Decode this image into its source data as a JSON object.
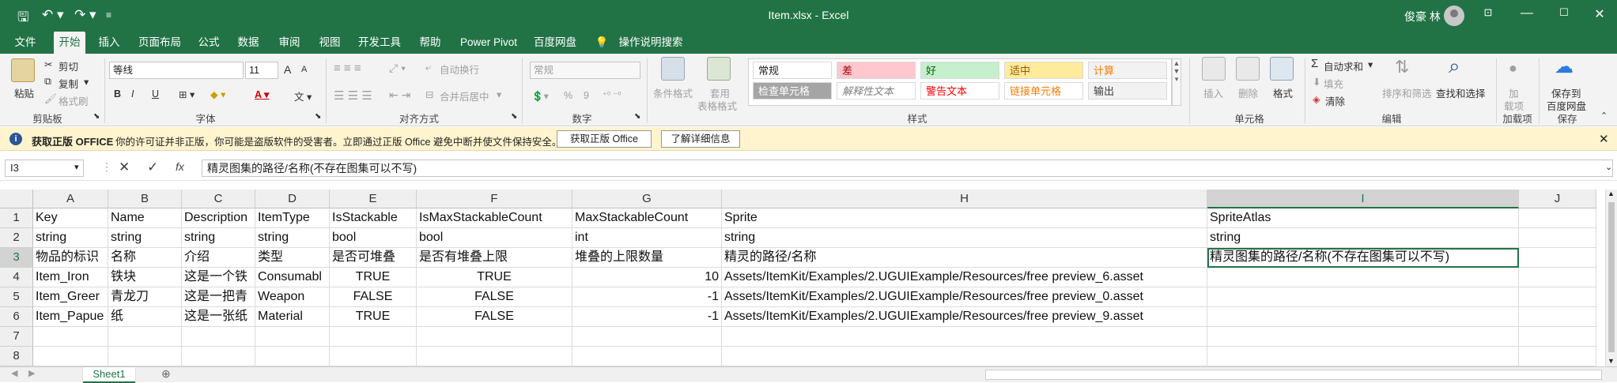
{
  "window": {
    "title": "Item.xlsx  -  Excel",
    "user": "俊豪 林",
    "accent": "#217346",
    "icons": {
      "save": "save-icon",
      "undo": "undo-icon",
      "redo": "redo-icon",
      "customize": "customize-quick-access-icon",
      "ribbon_display": "ribbon-display-options-icon",
      "minimize": "minimize-icon",
      "maximize": "maximize-icon",
      "close": "close-icon"
    }
  },
  "menu": {
    "tabs": [
      "文件",
      "开始",
      "插入",
      "页面布局",
      "公式",
      "数据",
      "审阅",
      "视图",
      "开发工具",
      "帮助",
      "Power Pivot",
      "百度网盘"
    ],
    "active": "开始",
    "search": "操作说明搜索"
  },
  "ribbon": {
    "clipboard": {
      "paste": "粘贴",
      "cut": "剪切",
      "copy": "复制",
      "format_painter": "格式刷",
      "label": "剪贴板"
    },
    "font": {
      "name": "等线",
      "size": "11",
      "grow": "A",
      "shrink": "A",
      "bold": "B",
      "italic": "I",
      "underline": "U",
      "label": "字体"
    },
    "alignment": {
      "wrap": "自动换行",
      "merge": "合并后居中",
      "label": "对齐方式"
    },
    "number": {
      "format": "常规",
      "percent": "%",
      "comma": "9",
      "label": "数字"
    },
    "styles": {
      "conditional": "条件格式",
      "table": "套用",
      "table2": "表格格式",
      "cells": [
        {
          "text": "常规",
          "bg": "#ffffff",
          "fg": "#222222"
        },
        {
          "text": "差",
          "bg": "#ffc7ce",
          "fg": "#9c0006"
        },
        {
          "text": "好",
          "bg": "#c6efce",
          "fg": "#006100"
        },
        {
          "text": "适中",
          "bg": "#ffeb9c",
          "fg": "#9c5700"
        },
        {
          "text": "计算",
          "bg": "#f2f2f2",
          "fg": "#fa7d00"
        },
        {
          "text": "检查单元格",
          "bg": "#a5a5a5",
          "fg": "#ffffff"
        },
        {
          "text": "解释性文本",
          "bg": "#ffffff",
          "fg": "#7f7f7f"
        },
        {
          "text": "警告文本",
          "bg": "#ffffff",
          "fg": "#ff0000"
        },
        {
          "text": "链接单元格",
          "bg": "#ffffff",
          "fg": "#fa7d00"
        },
        {
          "text": "输出",
          "bg": "#f2f2f2",
          "fg": "#3f3f3f"
        }
      ],
      "label": "样式"
    },
    "cells_group": {
      "insert": "插入",
      "delete": "删除",
      "format": "格式",
      "label": "单元格"
    },
    "editing": {
      "autosum": "自动求和",
      "fill": "填充",
      "clear": "清除",
      "sort": "排序和筛选",
      "find": "查找和选择",
      "label": "编辑"
    },
    "addins": {
      "add": "加",
      "add2": "载项",
      "label": "加载项"
    },
    "save": {
      "line1": "保存到",
      "line2": "百度网盘",
      "label": "保存"
    }
  },
  "message_bar": {
    "title": "获取正版 OFFICE",
    "text": "你的许可证并非正版，你可能是盗版软件的受害者。立即通过正版 Office 避免中断并使文件保持安全。",
    "button1": "获取正版 Office",
    "button2": "了解详细信息"
  },
  "formula_bar": {
    "name_box": "I3",
    "formula": "精灵图集的路径/名称(不存在图集可以不写)"
  },
  "grid": {
    "columns": [
      "A",
      "B",
      "C",
      "D",
      "E",
      "F",
      "G",
      "H",
      "I",
      "J"
    ],
    "rows": [
      "1",
      "2",
      "3",
      "4",
      "5",
      "6",
      "7",
      "8"
    ],
    "selected_column": "I",
    "selected_row": "3",
    "cells": [
      [
        "Key",
        "Name",
        "Description",
        "ItemType",
        "IsStackable",
        "IsMaxStackableCount",
        "MaxStackableCount",
        "Sprite",
        "SpriteAtlas",
        ""
      ],
      [
        "string",
        "string",
        "string",
        "string",
        "bool",
        "bool",
        "int",
        "string",
        "string",
        ""
      ],
      [
        "物品的标识",
        "名称",
        "介绍",
        "类型",
        "是否可堆叠",
        "是否有堆叠上限",
        "堆叠的上限数量",
        "精灵的路径/名称",
        "精灵图集的路径/名称(不存在图集可以不写)",
        ""
      ],
      [
        "Item_Iron",
        "铁块",
        "这是一个铁",
        "Consumabl",
        "TRUE",
        "TRUE",
        "10",
        "Assets/ItemKit/Examples/2.UGUIExample/Resources/free preview_6.asset",
        "",
        ""
      ],
      [
        "Item_Greer",
        "青龙刀",
        "这是一把青",
        "Weapon",
        "FALSE",
        "FALSE",
        "-1",
        "Assets/ItemKit/Examples/2.UGUIExample/Resources/free preview_0.asset",
        "",
        ""
      ],
      [
        "Item_Papue",
        "纸",
        "这是一张纸",
        "Material",
        "TRUE",
        "FALSE",
        "-1",
        "Assets/ItemKit/Examples/2.UGUIExample/Resources/free preview_9.asset",
        "",
        ""
      ],
      [
        "",
        "",
        "",
        "",
        "",
        "",
        "",
        "",
        "",
        ""
      ],
      [
        "",
        "",
        "",
        "",
        "",
        "",
        "",
        "",
        "",
        ""
      ]
    ]
  },
  "sheets": {
    "tabs": [
      "Sheet1"
    ],
    "active": "Sheet1"
  }
}
